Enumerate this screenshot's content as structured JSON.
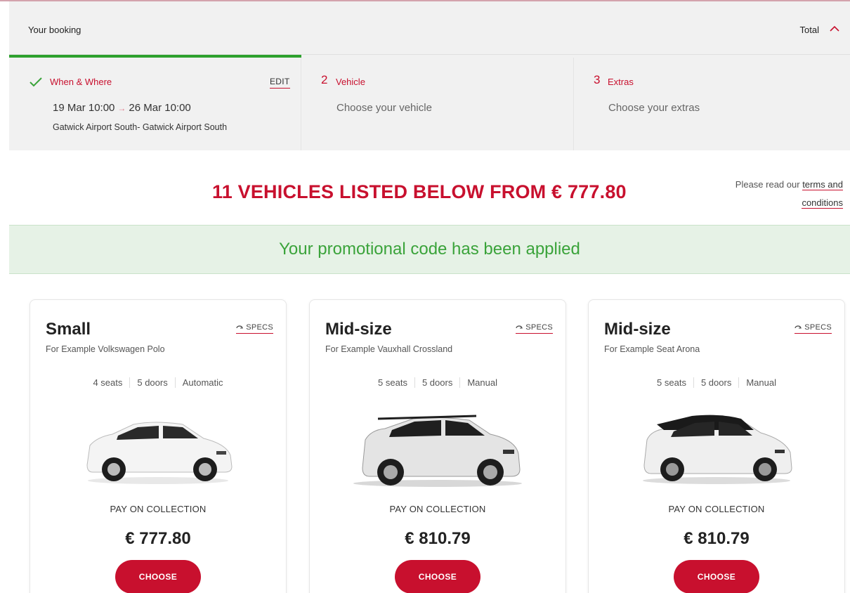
{
  "booking": {
    "title": "Your booking",
    "total_label": "Total",
    "steps": [
      {
        "label": "When & Where",
        "edit_label": "EDIT",
        "pickup": "19 Mar 10:00",
        "arrow": "→",
        "dropoff": "26 Mar 10:00",
        "location": "Gatwick Airport South- Gatwick Airport South"
      },
      {
        "number": "2",
        "label": "Vehicle",
        "subtitle": "Choose your vehicle"
      },
      {
        "number": "3",
        "label": "Extras",
        "subtitle": "Choose your extras"
      }
    ]
  },
  "headline": "11 VEHICLES LISTED BELOW FROM € 777.80",
  "terms": {
    "prefix": "Please read our ",
    "link_line1": "terms and",
    "link_line2": "conditions"
  },
  "promo": "Your promotional code has been applied",
  "vehicles": [
    {
      "category": "Small",
      "example": "For Example Volkswagen Polo",
      "specs_label": "SPECS",
      "seats": "4 seats",
      "doors": "5 doors",
      "transmission": "Automatic",
      "payment": "PAY ON COLLECTION",
      "price": "€ 777.80",
      "cta": "CHOOSE"
    },
    {
      "category": "Mid-size",
      "example": "For Example Vauxhall Crossland",
      "specs_label": "SPECS",
      "seats": "5 seats",
      "doors": "5 doors",
      "transmission": "Manual",
      "payment": "PAY ON COLLECTION",
      "price": "€ 810.79",
      "cta": "CHOOSE"
    },
    {
      "category": "Mid-size",
      "example": "For Example Seat Arona",
      "specs_label": "SPECS",
      "seats": "5 seats",
      "doors": "5 doors",
      "transmission": "Manual",
      "payment": "PAY ON COLLECTION",
      "price": "€ 810.79",
      "cta": "CHOOSE"
    }
  ],
  "colors": {
    "accent": "#c8102e",
    "success": "#3aa33a",
    "progress": "#2ea12e"
  },
  "icons": [
    "checkmark-icon",
    "chevron-up-icon",
    "rotate-icon",
    "car-image"
  ]
}
